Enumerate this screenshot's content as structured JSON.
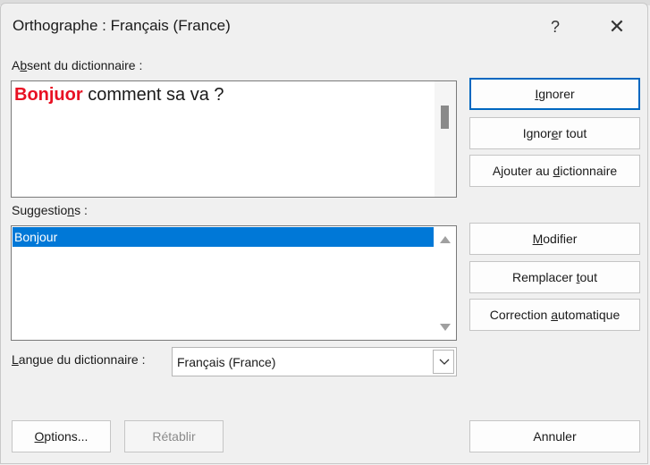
{
  "dialog": {
    "title": "Orthographe : Français (France)",
    "help": "?",
    "close": "✕"
  },
  "not_in_dictionary": {
    "label_pre": "A",
    "label_u": "b",
    "label_post": "sent du dictionnaire :",
    "error_word": "Bonjuor",
    "rest_text": " comment sa va ?"
  },
  "suggestions": {
    "label_pre": "Suggestio",
    "label_u": "n",
    "label_post": "s :",
    "items": [
      "Bonjour"
    ]
  },
  "language": {
    "label_pre": "",
    "label_u": "L",
    "label_post": "angue du dictionnaire :",
    "value": "Français (France)"
  },
  "buttons": {
    "ignore": {
      "pre": "",
      "u": "I",
      "post": "gnorer"
    },
    "ignore_all": {
      "pre": "Ignor",
      "u": "e",
      "post": "r tout"
    },
    "add_to_dict": {
      "pre": "Ajouter au ",
      "u": "d",
      "post": "ictionnaire"
    },
    "modify": {
      "pre": "",
      "u": "M",
      "post": "odifier"
    },
    "replace_all": {
      "pre": "Remplacer ",
      "u": "t",
      "post": "out"
    },
    "autocorrect": {
      "pre": "Correction ",
      "u": "a",
      "post": "utomatique"
    },
    "options": {
      "pre": "",
      "u": "O",
      "post": "ptions..."
    },
    "restore": {
      "label": "Rétablir"
    },
    "cancel": {
      "label": "Annuler"
    }
  },
  "colors": {
    "error": "#e81123",
    "selection": "#0078d7",
    "primary_border": "#0067c0"
  }
}
